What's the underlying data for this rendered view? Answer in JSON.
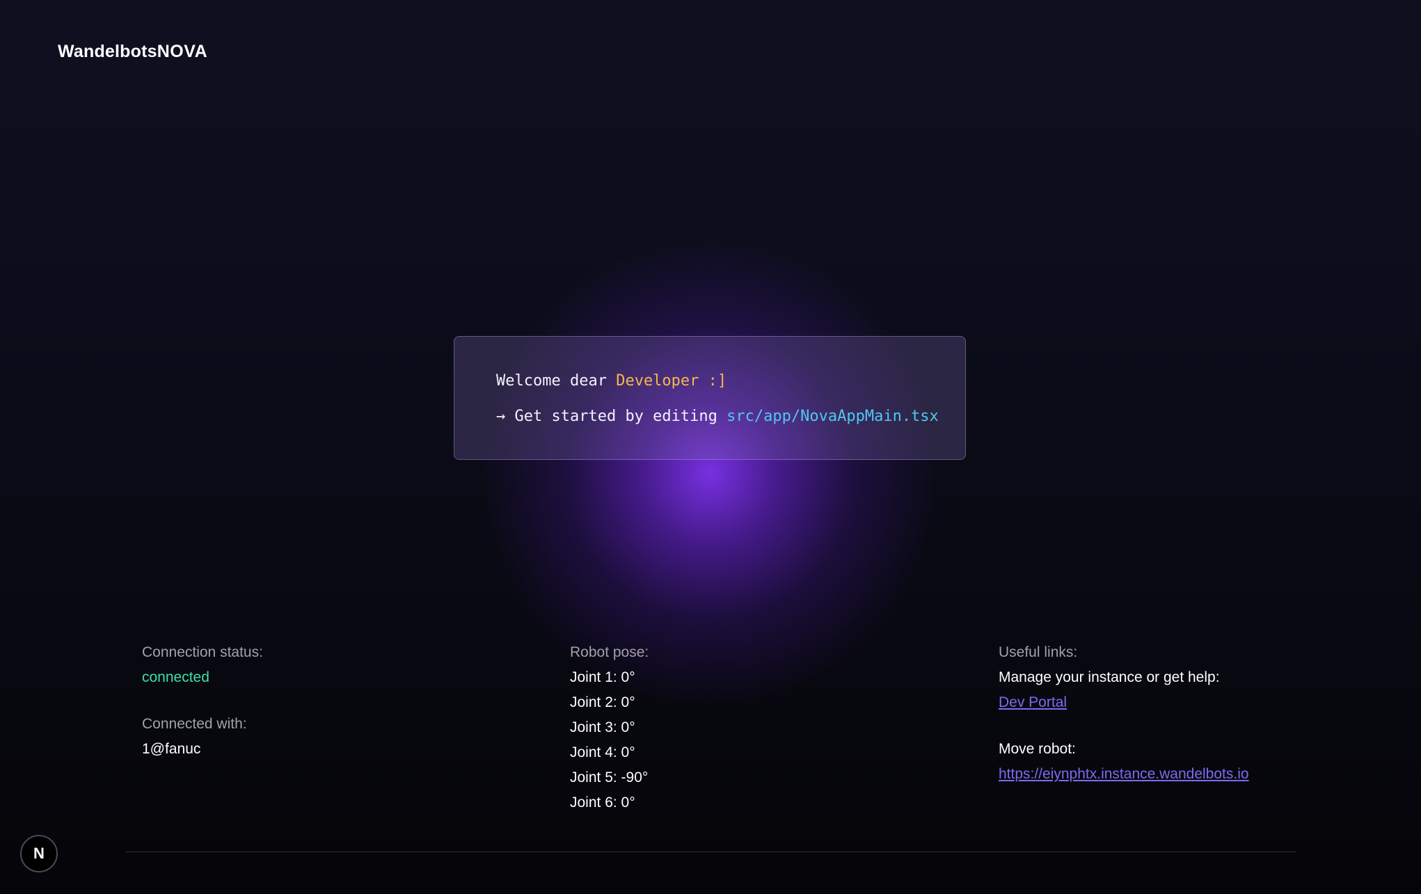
{
  "header": {
    "logo_wandelbots": "Wandelbots",
    "logo_nova": "NOVA"
  },
  "welcome": {
    "greeting": "Welcome dear",
    "name": "Developer :]",
    "arrow": "→",
    "instruction": "Get started by editing",
    "file_path": "src/app/NovaAppMain.tsx"
  },
  "connection": {
    "status_label": "Connection status:",
    "status_value": "connected",
    "with_label": "Connected with:",
    "with_value": "1@fanuc"
  },
  "robot_pose": {
    "label": "Robot pose:",
    "joints": [
      "Joint 1: 0°",
      "Joint 2: 0°",
      "Joint 3: 0°",
      "Joint 4: 0°",
      "Joint 5: -90°",
      "Joint 6: 0°"
    ]
  },
  "useful_links": {
    "label": "Useful links:",
    "manage_text": "Manage your instance or get help:",
    "dev_portal_label": "Dev Portal",
    "move_robot_text": "Move robot:",
    "instance_url": "https://eiynphtx.instance.wandelbots.io"
  },
  "badge": {
    "letter": "N",
    "icon": "nextjs-icon"
  },
  "colors": {
    "background": "#090a12",
    "glow": "#7d32eb",
    "accent_yellow": "#f3b84b",
    "accent_cyan": "#4fc8f0",
    "status_green": "#3ee0a1",
    "link": "#7a6cf2"
  }
}
